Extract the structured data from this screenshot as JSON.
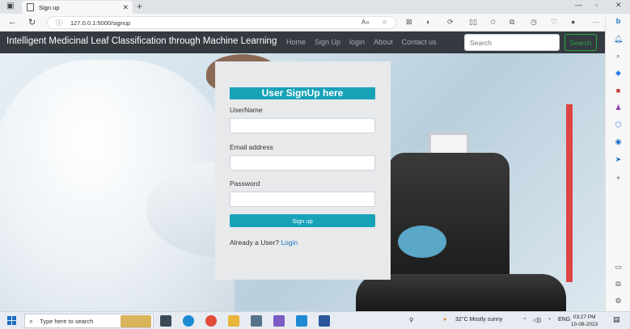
{
  "browser": {
    "tab_title": "Sign up",
    "url": "127.0.0.1:5000/signup"
  },
  "navbar": {
    "brand": "Intelligent Medicinal Leaf Classification through Machine Learning",
    "links": [
      "Home",
      "Sign Up",
      "login",
      "About",
      "Contact us"
    ],
    "search_placeholder": "Search",
    "search_button": "Search"
  },
  "form": {
    "title": "User SignUp here",
    "username_label": "UserName",
    "email_label": "Email address",
    "password_label": "Password",
    "submit_label": "Sign up",
    "already_text": "Already a User?",
    "login_link": "Login"
  },
  "taskbar": {
    "search_placeholder": "Type here to search",
    "weather": "32°C  Mostly sunny",
    "language": "ENG",
    "time": "03:27 PM",
    "date": "10-08-2023"
  },
  "colors": {
    "navbar_bg": "#343a40",
    "accent": "#17a2b8",
    "search_btn": "#28a745",
    "link": "#1a73c8"
  },
  "icons": {
    "tab_favicon": "page-icon",
    "back": "back-arrow-icon",
    "refresh": "refresh-icon",
    "info": "info-icon",
    "search": "search-icon",
    "windows": "windows-logo-icon"
  }
}
